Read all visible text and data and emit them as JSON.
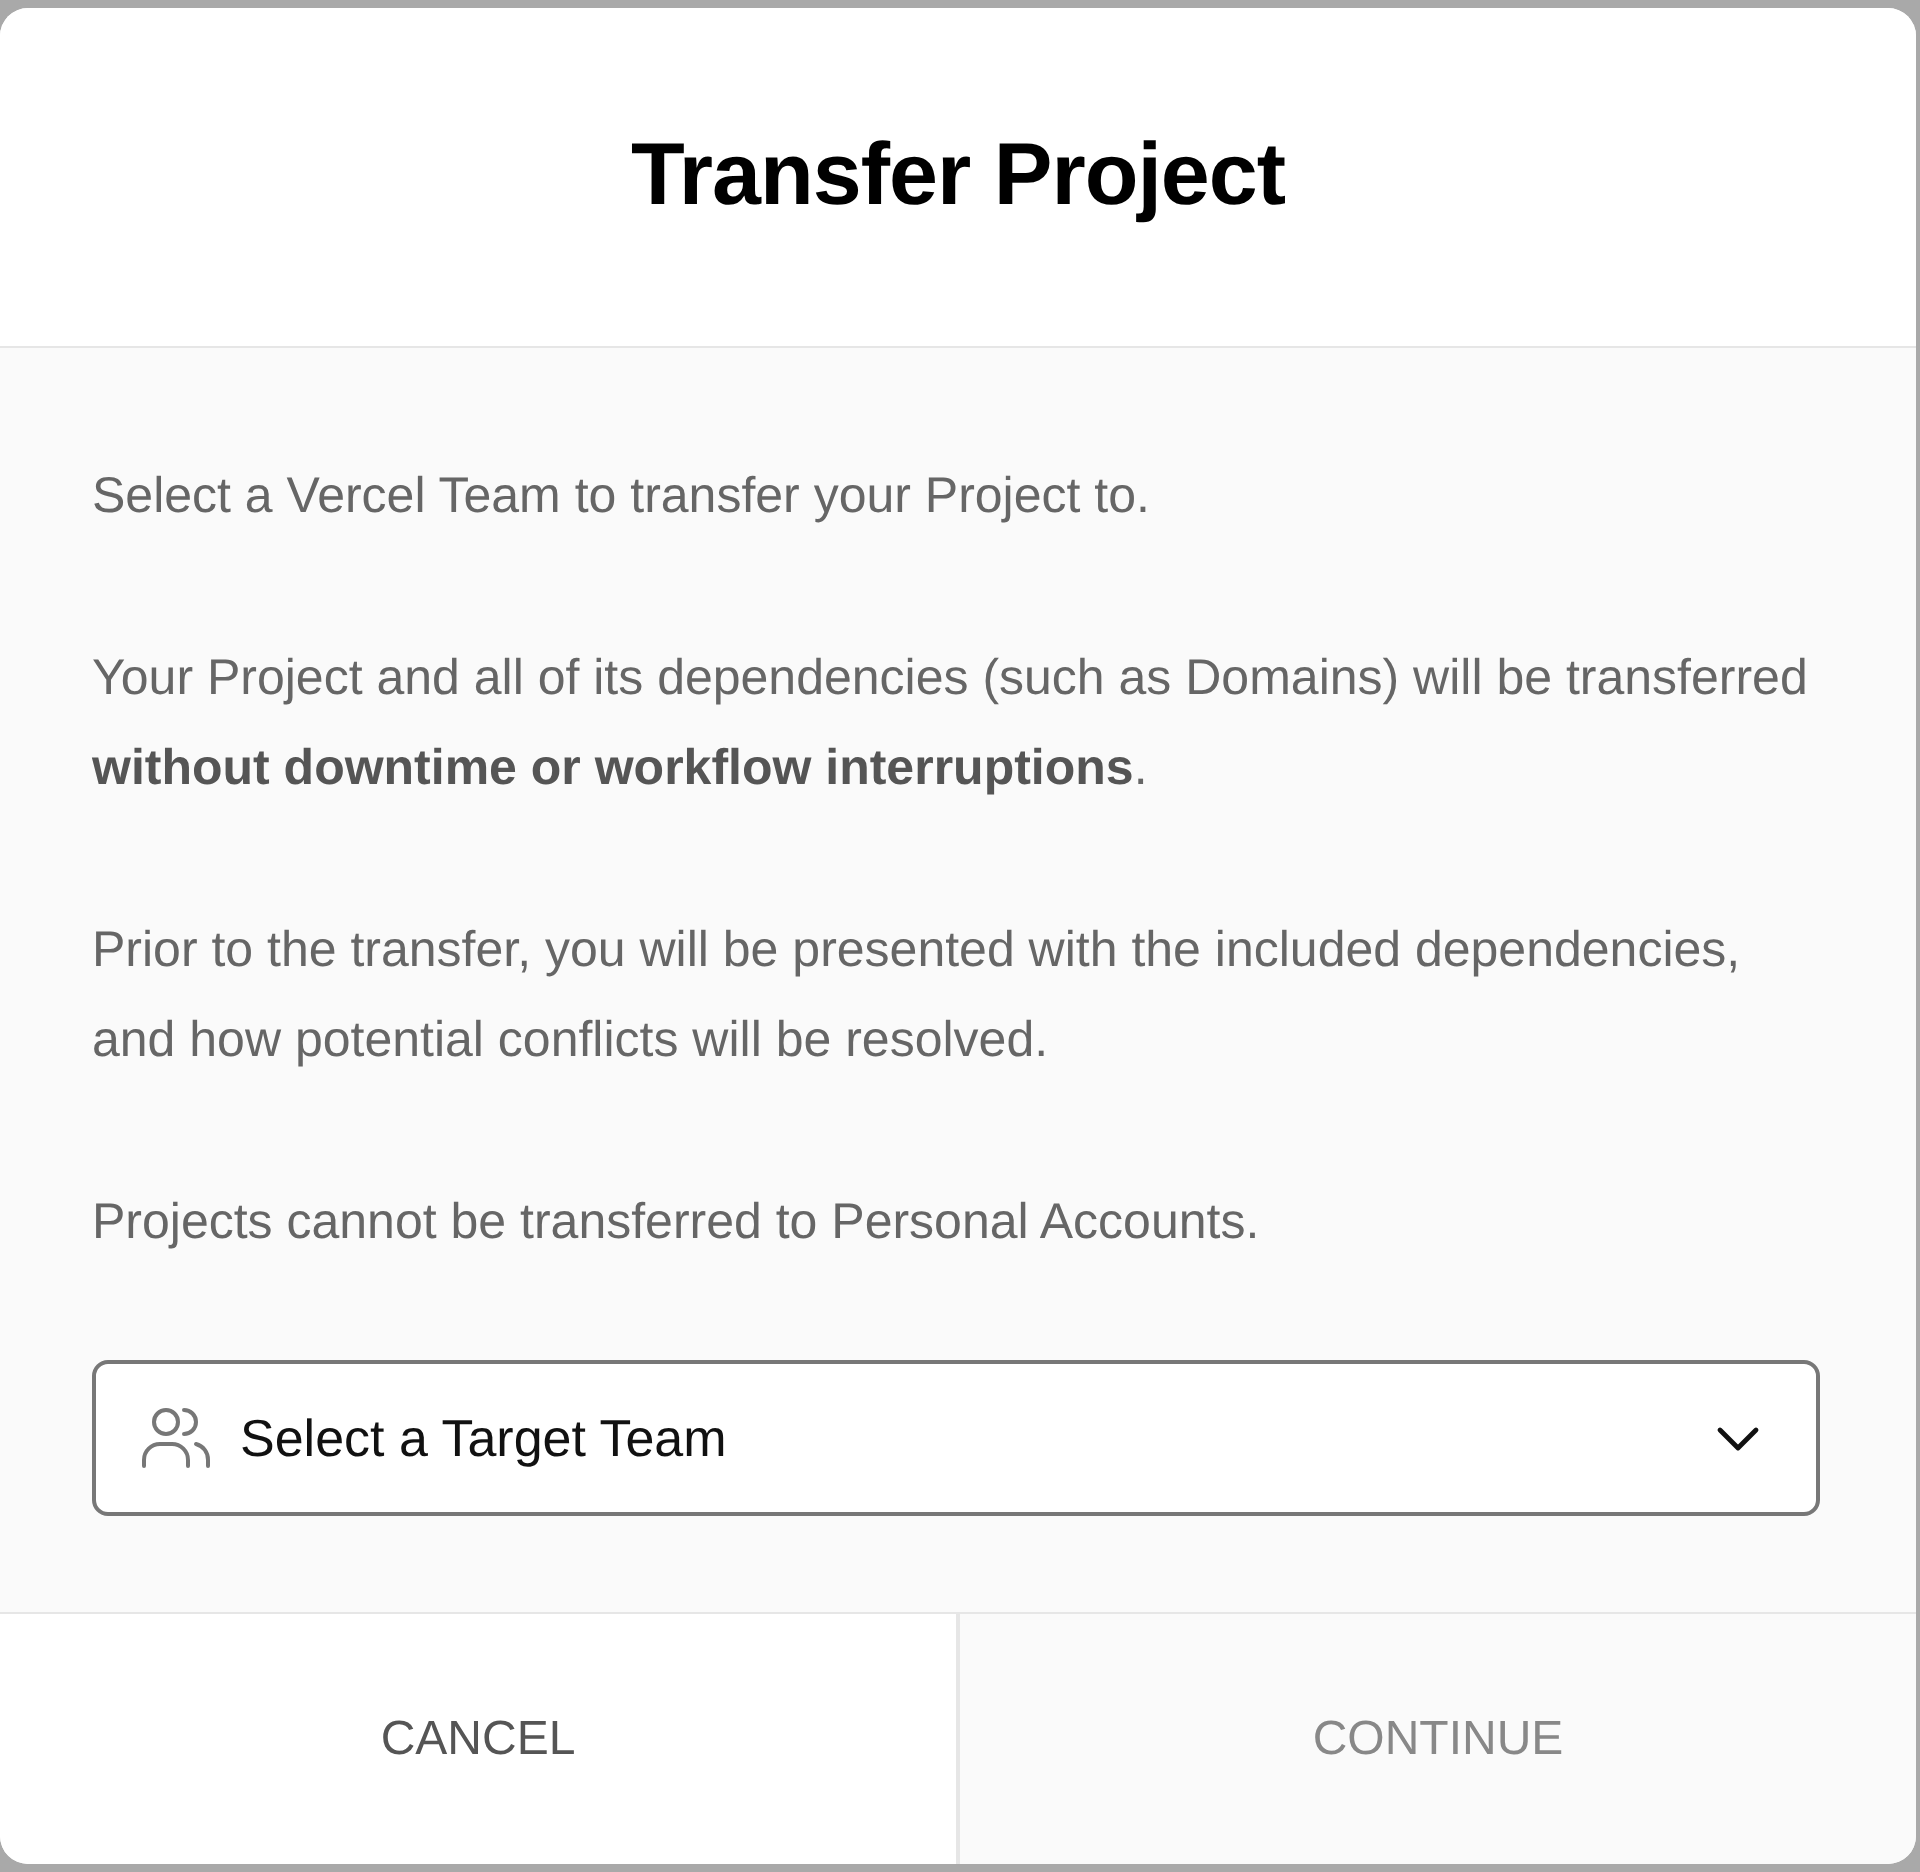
{
  "dialog": {
    "title": "Transfer Project",
    "paragraphs": [
      "Select a Vercel Team to transfer your Project to.",
      "Your Project and all of its dependencies (such as Domains) will be transferred **without downtime or workflow interruptions**.",
      "Prior to the transfer, you will be presented with the included dependencies, and how potential conflicts will be resolved.",
      "Projects cannot be transferred to Personal Accounts."
    ],
    "team_select": {
      "placeholder": "Select a Target Team"
    },
    "buttons": [
      {
        "label": "CANCEL",
        "disabled": false
      },
      {
        "label": "CONTINUE",
        "disabled": true
      }
    ]
  }
}
